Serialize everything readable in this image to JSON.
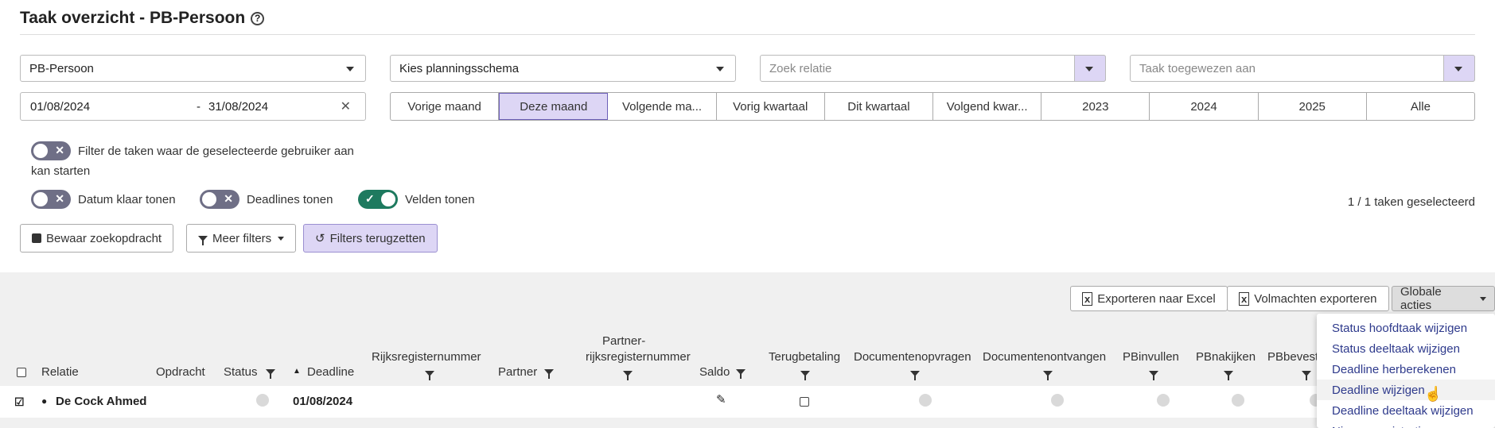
{
  "header": {
    "title": "Taak overzicht - PB-Persoon",
    "help_icon": "?"
  },
  "filters": {
    "type_select": "PB-Persoon",
    "schema_select": "Kies planningsschema",
    "relation_placeholder": "Zoek relatie",
    "assignee_placeholder": "Taak toegewezen aan",
    "date_from": "01/08/2024",
    "date_sep": "-",
    "date_to": "31/08/2024",
    "clear": "✕",
    "periods": [
      "Vorige maand",
      "Deze maand",
      "Volgende ma...",
      "Vorig kwartaal",
      "Dit kwartaal",
      "Volgend kwar...",
      "2023",
      "2024",
      "2025",
      "Alle"
    ],
    "active_period": "Deze maand"
  },
  "toggles": {
    "start_filter_line1": "Filter de taken waar de geselecteerde gebruiker aan",
    "start_filter_line2": "kan starten",
    "datum_klaar": "Datum klaar tonen",
    "deadlines": "Deadlines tonen",
    "velden": "Velden tonen"
  },
  "selection_count": "1 / 1 taken geselecteerd",
  "buttons": {
    "save_search": "Bewaar zoekopdracht",
    "more_filters": "Meer filters",
    "reset_filters": "Filters terugzetten",
    "export_excel": "Exporteren naar Excel",
    "export_mandates": "Volmachten exporteren",
    "global_actions": "Globale acties"
  },
  "table": {
    "headers": {
      "relatie": "Relatie",
      "opdracht": "Opdracht",
      "status": "Status",
      "deadline": "Deadline",
      "rijksregister": "Rijksregisternummer",
      "partner": "Partner",
      "partner_rijks_1": "Partner-",
      "partner_rijks_2": "rijksregisternummer",
      "saldo": "Saldo",
      "terugbetaling": "Terugbetaling",
      "docs_opvragen": "Documentenopvragen",
      "docs_ontvangen": "Documentenontvangen",
      "pbinvullen": "PBinvullen",
      "pbnakijken": "PBnakijken",
      "pbbevest": "PBbevest"
    },
    "row": {
      "name": "De Cock Ahmed",
      "deadline": "01/08/2024"
    }
  },
  "global_actions_menu": [
    "Status hoofdtaak wijzigen",
    "Status deeltaak wijzigen",
    "Deadline herberekenen",
    "Deadline wijzigen",
    "Deadline deeltaak wijzigen",
    "Nieuwe registratie"
  ],
  "colors": {
    "accent": "#ddd6f5",
    "toggle_on": "#1e7a5f",
    "toggle_off": "#6f6f86",
    "menu_text": "#2e3a8c"
  }
}
